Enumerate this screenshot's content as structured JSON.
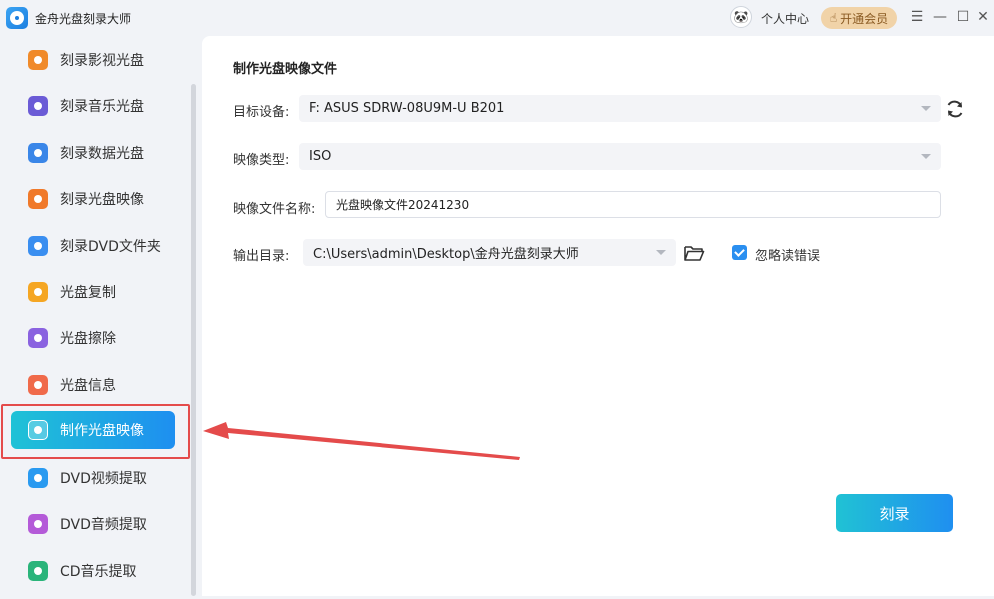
{
  "window": {
    "title": "金舟光盘刻录大师",
    "user_center": "个人中心",
    "vip_label": "开通会员",
    "menu_icon": "☰",
    "minimize_icon": "—",
    "maximize_icon": "☐",
    "close_icon": "✕"
  },
  "sidebar": {
    "items": [
      {
        "label": "刻录影视光盘",
        "icon": "video-disc-icon",
        "color": "#f08a2a"
      },
      {
        "label": "刻录音乐光盘",
        "icon": "music-disc-icon",
        "color": "#6b5bd6"
      },
      {
        "label": "刻录数据光盘",
        "icon": "data-disc-icon",
        "color": "#3a86e8"
      },
      {
        "label": "刻录光盘映像",
        "icon": "image-disc-icon",
        "color": "#f0792a"
      },
      {
        "label": "刻录DVD文件夹",
        "icon": "dvd-folder-icon",
        "color": "#3a8ef0"
      },
      {
        "label": "光盘复制",
        "icon": "copy-disc-icon",
        "color": "#f5a623"
      },
      {
        "label": "光盘擦除",
        "icon": "erase-disc-icon",
        "color": "#8a62e0"
      },
      {
        "label": "光盘信息",
        "icon": "info-disc-icon",
        "color": "#f06a4a"
      },
      {
        "label": "制作光盘映像",
        "icon": "make-image-icon",
        "color": "#ffffff"
      },
      {
        "label": "DVD视频提取",
        "icon": "dvd-video-extract-icon",
        "color": "#2a9af0"
      },
      {
        "label": "DVD音频提取",
        "icon": "dvd-audio-extract-icon",
        "color": "#b45ad8"
      },
      {
        "label": "CD音乐提取",
        "icon": "cd-music-extract-icon",
        "color": "#2ab47a"
      }
    ],
    "active_index": 8
  },
  "main": {
    "section_title": "制作光盘映像文件",
    "target_device_label": "目标设备:",
    "target_device_value": "F: ASUS SDRW-08U9M-U B201",
    "image_type_label": "映像类型:",
    "image_type_value": "ISO",
    "image_name_label": "映像文件名称:",
    "image_name_value": "光盘映像文件20241230",
    "output_dir_label": "输出目录:",
    "output_dir_value": "C:\\Users\\admin\\Desktop\\金舟光盘刻录大师",
    "ignore_errors_label": "忽略读错误",
    "ignore_errors_checked": true,
    "burn_button": "刻录"
  },
  "colors": {
    "accent_gradient_start": "#1fc2d6",
    "accent_gradient_end": "#1e8ff0",
    "annotation_red": "#e44b4b"
  }
}
